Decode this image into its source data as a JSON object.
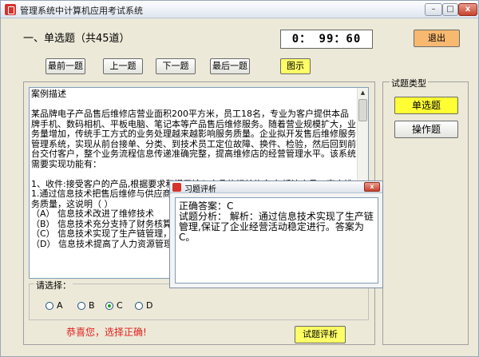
{
  "window": {
    "title": "管理系统中计算机应用考试系统",
    "minimize_label": "–",
    "maximize_label": "□",
    "close_label": "x"
  },
  "header": {
    "section_heading": "一、单选题（共45道）",
    "timer": "0： 99：60",
    "exit_label": "退出"
  },
  "nav": {
    "first_label": "最前一题",
    "prev_label": "上一题",
    "next_label": "下一题",
    "last_label": "最后一题",
    "diagram_label": "图示"
  },
  "question": {
    "text": "案例描述\n\n某品牌电子产品售后维修店营业面积200平方米，员工18名，专业为客户提供本品牌手机、数码相机、平板电脑、笔记本等产品售后维修服务。随着营业规模扩大，业务量增加，传统手工方式的业务处理越来越影响服务质量。企业拟开发售后维修服务管理系统，实现从前台接单、分类、到技术员工定位故障、换件、检验，然后回到前台交付客户，整个业务流程信息传递准确完整，提高维修店的经营管理水平。该系统需要实现功能有：\n\n1、收件:接受客户的产品,根据要求和提示输入产品的相关信息,包括流水号、客户姓\n1.通过信息技术把售后维修与供应商、\n务质量，这说明（ ）\n（A） 信息技术改进了维修技术\n（B） 信息技术充分支持了财务核算监\n（C） 信息技术实现了生产链管理，保证\n（D） 信息技术提高了人力资源管理质"
  },
  "answer": {
    "legend": "请选择：",
    "options": [
      {
        "label": "A",
        "selected": false
      },
      {
        "label": "B",
        "selected": false
      },
      {
        "label": "C",
        "selected": true
      },
      {
        "label": "D",
        "selected": false
      }
    ],
    "result_message": "恭喜您，选择正确!",
    "analysis_button": "试题评析"
  },
  "question_types": {
    "legend": "试题类型",
    "single_choice": "单选题",
    "operation": "操作题"
  },
  "popup": {
    "title": "习题评析",
    "close_label": "x",
    "text": "正确答案：C\n试题分析： 解析：通过信息技术实现了生产链管理,保证了企业经营活动稳定进行。答案为C。"
  },
  "colors": {
    "highlight_yellow": "#ffff66",
    "exit_orange": "#f7b870",
    "success_red": "#e02020",
    "selected_radio": "#21a121"
  }
}
